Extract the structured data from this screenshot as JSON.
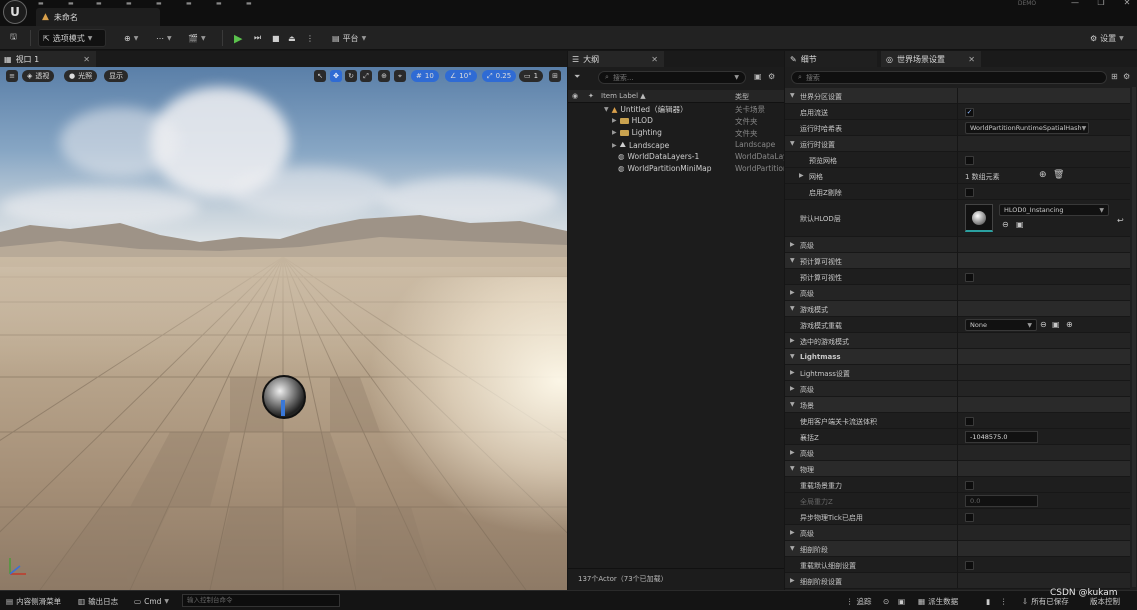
{
  "title_bar": {
    "doc_tab": "未命名",
    "demo_badge": "DEMO"
  },
  "toolbar": {
    "select_mode": "选项模式",
    "platforms": "平台",
    "settings": "设置"
  },
  "viewport": {
    "tab": "视口 1",
    "perspective": "透视",
    "lit": "光照",
    "show": "显示",
    "grid_snap": "10",
    "rotation_snap": "10°",
    "scale_snap": "0.25",
    "camera_speed": "1"
  },
  "outliner": {
    "tab": "大纲",
    "search_placeholder": "搜索...",
    "header_label": "Item Label ▲",
    "header_type": "类型",
    "rows": [
      {
        "label": "Untitled（编辑器）",
        "type": "关卡场景"
      },
      {
        "label": "HLOD",
        "type": "文件夹"
      },
      {
        "label": "Lighting",
        "type": "文件夹"
      },
      {
        "label": "Landscape",
        "type": "Landscape"
      },
      {
        "label": "WorldDataLayers-1",
        "type": "WorldDataLay"
      },
      {
        "label": "WorldPartitionMiniMap",
        "type": "WorldPartition"
      }
    ],
    "footer": "137个Actor（73个已加载）"
  },
  "details": {
    "tab_details": "细节",
    "tab_world_settings": "世界场景设置",
    "search_placeholder": "搜索",
    "rows": {
      "r1": "世界分区设置",
      "r2": "启用流送",
      "r3": "运行时哈希表",
      "r3_value": "WorldPartitionRuntimeSpatialHash",
      "r4": "运行时设置",
      "r5": "预览网格",
      "r6": "网格",
      "r6_value": "1 数组元素",
      "r7": "启用Z剔除",
      "r8": "默认HLOD层",
      "r8_value": "HLOD0_Instancing",
      "r9": "高级",
      "r10": "预计算可视性",
      "r11": "预计算可视性",
      "r12": "高级",
      "r13": "游戏模式",
      "r14": "游戏模式重载",
      "r14_value": "None",
      "r15": "选中的游戏模式",
      "r16": "Lightmass",
      "r17": "Lightmass设置",
      "r18": "高级",
      "r19": "场景",
      "r20": "使用客户端关卡流送体积",
      "r21": "襄括Z",
      "r21_value": "-1048575.0",
      "r22": "高级",
      "r23": "物理",
      "r24": "重载场景重力",
      "r25": "全局重力Z",
      "r25_value": "0.0",
      "r26": "异步物理Tick已启用",
      "r27": "高级",
      "r28": "细剖阶段",
      "r29": "重载默认细剖设置",
      "r30": "细剖阶段设置"
    }
  },
  "statusbar": {
    "content_drawer": "内容侧滑菜单",
    "output_log": "输出日志",
    "cmd": "Cmd",
    "cmd_placeholder": "输入控制台命令",
    "trace": "追踪",
    "derived_data": "派生数据",
    "all_saved": "所有已保存",
    "source_control": "版本控制"
  },
  "watermark": "CSDN @kukam"
}
